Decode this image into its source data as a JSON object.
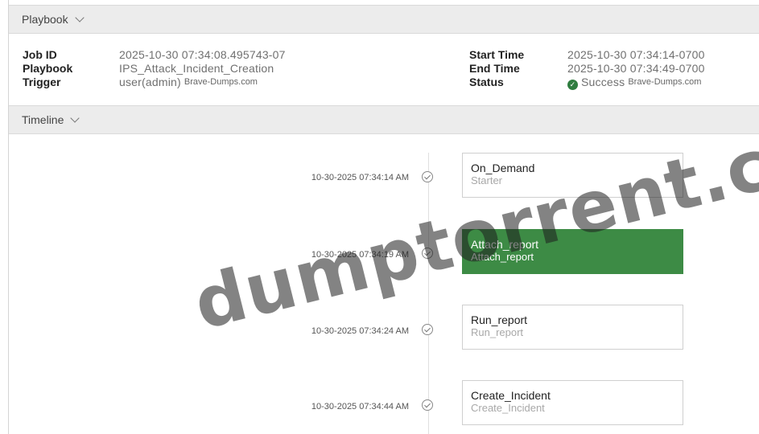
{
  "playbook_section": {
    "title": "Playbook"
  },
  "job": {
    "left": [
      {
        "label": "Job ID",
        "value": "2025-10-30 07:34:08.495743-07"
      },
      {
        "label": "Playbook",
        "value": "IPS_Attack_Incident_Creation"
      },
      {
        "label": "Trigger",
        "value": "user(admin)",
        "extra": "Brave-Dumps.com"
      }
    ],
    "right": [
      {
        "label": "Start Time",
        "value": "2025-10-30 07:34:14-0700"
      },
      {
        "label": "End Time",
        "value": "2025-10-30 07:34:49-0700"
      },
      {
        "label": "Status",
        "value": "Success",
        "extra": "Brave-Dumps.com"
      }
    ]
  },
  "timeline_section": {
    "title": "Timeline"
  },
  "timeline": [
    {
      "time": "10-30-2025 07:34:14 AM",
      "name": "On_Demand",
      "sub": "Starter",
      "active": false
    },
    {
      "time": "10-30-2025 07:34:19 AM",
      "name": "Attach_report",
      "sub": "Attach_report",
      "active": true
    },
    {
      "time": "10-30-2025 07:34:24 AM",
      "name": "Run_report",
      "sub": "Run_report",
      "active": false
    },
    {
      "time": "10-30-2025 07:34:44 AM",
      "name": "Create_Incident",
      "sub": "Create_Incident",
      "active": false
    }
  ],
  "watermark": "dumptorrent.co",
  "colors": {
    "active_task": "#3d8b45",
    "success": "#2f7d3f",
    "header_bg": "#ececec"
  }
}
